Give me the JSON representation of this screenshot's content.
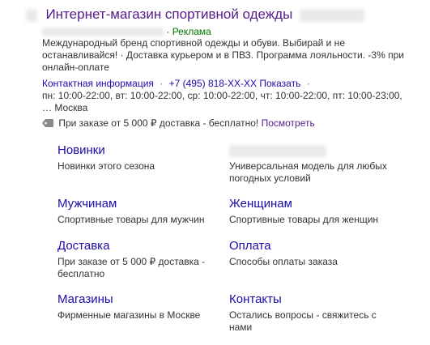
{
  "ad": {
    "title": "Интернет-магазин спортивной одежды",
    "ad_label": "Реклама",
    "description": "Международный бренд спортивной одежды и обуви. Выбирай          и не останавливайся! · Доставка курьером и в ПВЗ. Программа лояльности. -3% при онлайн-оплате",
    "contact_label": "Контактная информация",
    "phone": "+7 (495) 818-XX-XX",
    "phone_action": "Показать",
    "hours": "пн: 10:00-22:00, вт: 10:00-22:00, ср: 10:00-22:00, чт: 10:00-22:00, пт: 10:00-23:00, … Москва",
    "promo_text": "При заказе от 5 000 ₽ доставка - бесплатно!",
    "promo_link": "Посмотреть",
    "promo_icon": "tag-icon"
  },
  "sitelinks": [
    {
      "title": "Новинки",
      "desc": "Новинки этого сезона"
    },
    {
      "title": "",
      "desc": "Универсальная модель для любых погодных условий"
    },
    {
      "title": "Мужчинам",
      "desc": "Спортивные товары для мужчин"
    },
    {
      "title": "Женщинам",
      "desc": "Спортивные товары для женщин"
    },
    {
      "title": "Доставка",
      "desc": "При заказе от 5 000 ₽ доставка - бесплатно"
    },
    {
      "title": "Оплата",
      "desc": "Способы оплаты заказа"
    },
    {
      "title": "Магазины",
      "desc": "Фирменные магазины в Москве"
    },
    {
      "title": "Контакты",
      "desc": "Остались вопросы - свяжитесь с нами"
    }
  ]
}
